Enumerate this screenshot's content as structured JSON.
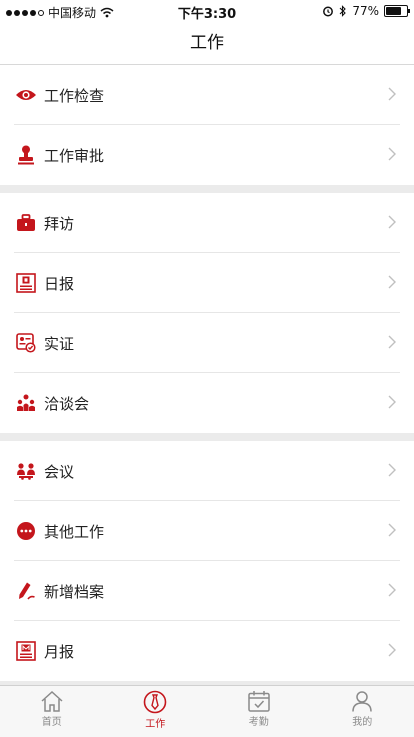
{
  "status_bar": {
    "carrier": "中国移动",
    "time": "下午3:30",
    "battery": "77%",
    "battery_level": 0.77
  },
  "nav": {
    "title": "工作"
  },
  "groups": [
    [
      {
        "label": "工作检查",
        "icon": "eye-icon"
      },
      {
        "label": "工作审批",
        "icon": "stamp-icon"
      }
    ],
    [
      {
        "label": "拜访",
        "icon": "briefcase-icon"
      },
      {
        "label": "日报",
        "icon": "daily-report-icon"
      },
      {
        "label": "实证",
        "icon": "certificate-icon"
      },
      {
        "label": "洽谈会",
        "icon": "people-group-icon"
      }
    ],
    [
      {
        "label": "会议",
        "icon": "meeting-icon"
      },
      {
        "label": "其他工作",
        "icon": "more-dots-icon"
      },
      {
        "label": "新增档案",
        "icon": "pen-icon"
      },
      {
        "label": "月报",
        "icon": "monthly-report-icon"
      }
    ]
  ],
  "tabs": [
    {
      "label": "首页",
      "icon": "home-icon",
      "active": false
    },
    {
      "label": "工作",
      "icon": "work-tie-icon",
      "active": true
    },
    {
      "label": "考勤",
      "icon": "calendar-check-icon",
      "active": false
    },
    {
      "label": "我的",
      "icon": "person-icon",
      "active": false
    }
  ],
  "colors": {
    "accent": "#c4161c",
    "inactive": "#8a8a8a"
  }
}
